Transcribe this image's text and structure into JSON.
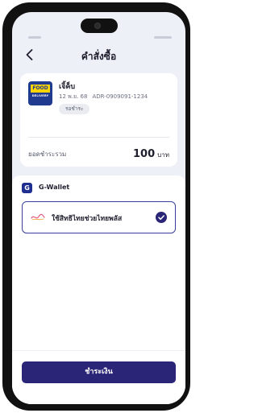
{
  "header": {
    "title": "คำสั่งซื้อ",
    "back_icon": "chevron-left-icon"
  },
  "order": {
    "merchant_logo": {
      "top": "FOOD",
      "bottom": "DELIVERY"
    },
    "merchant_name": "เจิ้ค็บ",
    "date": "12 พ.ย. 68",
    "reference": "ADR-0909091-1234",
    "status": "รอชำระ",
    "total_label": "ยอดชำระรวม",
    "total_amount": "100",
    "total_unit": "บาท"
  },
  "wallet": {
    "logo_letter": "G",
    "name": "G-Wallet",
    "option_label": "ใช้สิทธิไทยช่วยไทยพลัส",
    "option_selected": true,
    "check_icon": "check-circle-icon"
  },
  "footer": {
    "pay_button": "ชำระเงิน"
  },
  "colors": {
    "primary": "#2b2578",
    "wallet_blue": "#1f2f8f",
    "background": "#eef0f7"
  }
}
